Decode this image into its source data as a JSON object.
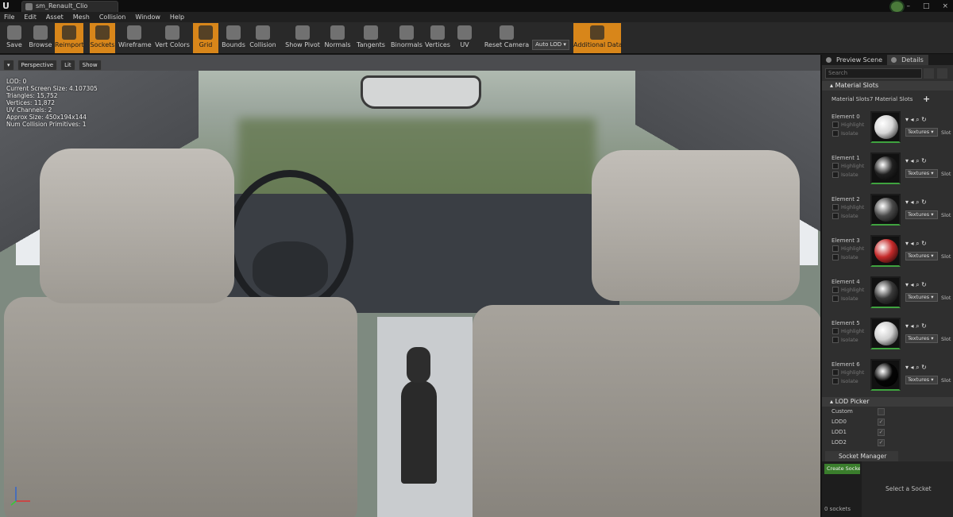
{
  "title_bar": {
    "logo": "U",
    "document_tab": "sm_Renault_Clio",
    "window_buttons": [
      "–",
      "□",
      "×"
    ]
  },
  "menu": [
    "File",
    "Edit",
    "Asset",
    "Mesh",
    "Collision",
    "Window",
    "Help"
  ],
  "toolbar": {
    "buttons": [
      {
        "label": "Save",
        "icon": "save-icon",
        "active": false
      },
      {
        "label": "Browse",
        "icon": "browse-icon",
        "active": false
      },
      {
        "label": "Reimport",
        "icon": "reimport-icon",
        "active": true
      },
      {
        "label": "Sockets",
        "icon": "sockets-icon",
        "active": true
      },
      {
        "label": "Wireframe",
        "icon": "wireframe-icon",
        "active": false
      },
      {
        "label": "Vert Colors",
        "icon": "vert-colors-icon",
        "active": false
      },
      {
        "label": "Grid",
        "icon": "grid-icon",
        "active": true
      },
      {
        "label": "Bounds",
        "icon": "bounds-icon",
        "active": false
      },
      {
        "label": "Collision",
        "icon": "collision-icon",
        "active": false
      },
      {
        "label": "Show Pivot",
        "icon": "pivot-icon",
        "active": false
      },
      {
        "label": "Normals",
        "icon": "normals-icon",
        "active": false
      },
      {
        "label": "Tangents",
        "icon": "tangents-icon",
        "active": false
      },
      {
        "label": "Binormals",
        "icon": "binormals-icon",
        "active": false
      },
      {
        "label": "Vertices",
        "icon": "vertices-icon",
        "active": false
      },
      {
        "label": "UV",
        "icon": "uv-icon",
        "active": false
      },
      {
        "label": "Reset Camera",
        "icon": "camera-icon",
        "active": false
      },
      {
        "label": "Additional Data",
        "icon": "additional-data-icon",
        "active": true
      }
    ],
    "auto_lod": "Auto LOD"
  },
  "viewport": {
    "view_menu": "▾",
    "perspective": "Perspective",
    "lit": "Lit",
    "show": "Show",
    "stats": [
      "LOD:  0",
      "Current Screen Size:  4.107305",
      "Triangles:  15,752",
      "Vertices:  11,872",
      "UV Channels:  2",
      "Approx Size:  450x194x144",
      "Num Collision Primitives:  1"
    ]
  },
  "panel": {
    "tabs": [
      "Preview Scene",
      "Details"
    ],
    "search_placeholder": "Search",
    "material_slots": {
      "header": "Material Slots",
      "row_label": "Material Slots",
      "row_value": "7 Material Slots",
      "add": "+",
      "elements": [
        {
          "name": "Element 0",
          "highlight": "Highlight",
          "isolate": "Isolate",
          "texture": "Textures",
          "slot": "Slot",
          "color": "#d7d7d7"
        },
        {
          "name": "Element 1",
          "highlight": "Highlight",
          "isolate": "Isolate",
          "texture": "Textures",
          "slot": "Slot",
          "color": "#202020"
        },
        {
          "name": "Element 2",
          "highlight": "Highlight",
          "isolate": "Isolate",
          "texture": "Textures",
          "slot": "Slot",
          "color": "#4a4a4a"
        },
        {
          "name": "Element 3",
          "highlight": "Highlight",
          "isolate": "Isolate",
          "texture": "Textures",
          "slot": "Slot",
          "color": "#c52a2a"
        },
        {
          "name": "Element 4",
          "highlight": "Highlight",
          "isolate": "Isolate",
          "texture": "Textures",
          "slot": "Slot",
          "color": "#3a3a3a"
        },
        {
          "name": "Element 5",
          "highlight": "Highlight",
          "isolate": "Isolate",
          "texture": "Textures",
          "slot": "Slot",
          "color": "#cfcfcf"
        },
        {
          "name": "Element 6",
          "highlight": "Highlight",
          "isolate": "Isolate",
          "texture": "Textures",
          "slot": "Slot",
          "color": "#050505"
        }
      ]
    },
    "lod_picker": {
      "header": "LOD Picker",
      "rows": [
        {
          "label": "Custom",
          "checked": false
        },
        {
          "label": "LOD0",
          "checked": true
        },
        {
          "label": "LOD1",
          "checked": true
        },
        {
          "label": "LOD2",
          "checked": true
        }
      ]
    },
    "socket_manager": {
      "tab": "Socket Manager",
      "create_button": "Create Socket",
      "count": "0 sockets",
      "select_hint": "Select a Socket"
    }
  },
  "colors": {
    "accent_orange": "#d8861a",
    "green_button": "#3a7d2c"
  }
}
